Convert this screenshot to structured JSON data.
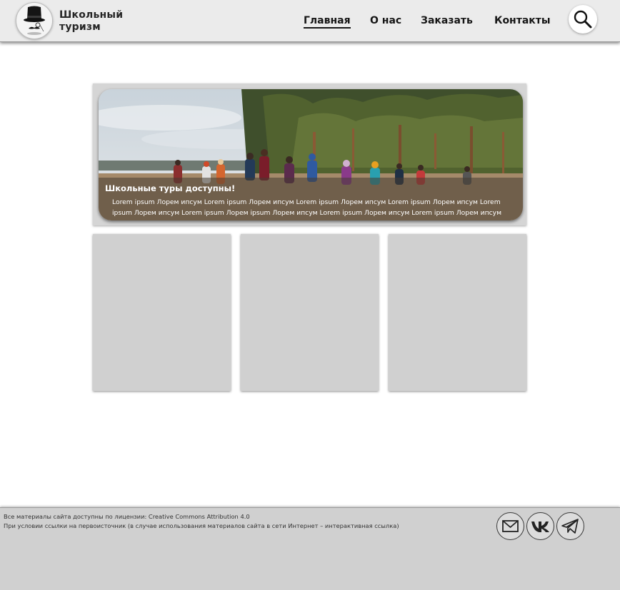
{
  "header": {
    "brand_line1": "Школьный",
    "brand_line2": "туризм",
    "logo_icon": "top-hat-mustache-icon",
    "nav": {
      "home": "Главная",
      "about": "О нас",
      "order": "Заказать",
      "contacts": "Контакты"
    },
    "active_nav": "home",
    "search_icon": "search-icon"
  },
  "hero": {
    "title": "Школьные туры доступны!",
    "text": "Lorem ipsum Лорем ипсум Lorem ipsum Лорем ипсум Lorem ipsum Лорем ипсум Lorem ipsum Лорем ипсум Lorem ipsum Лорем ипсум Lorem ipsum Лорем ipsum Лорем ипсум Lorem ipsum Лорем ипсум Lorem ipsum Лорем ипсум"
  },
  "cards": [
    {
      "id": "card-1"
    },
    {
      "id": "card-2"
    },
    {
      "id": "card-3"
    }
  ],
  "footer": {
    "license_line": "Все материалы сайта доступны по лицензии: Creative Commons Attribution 4.0",
    "attribution_line": "При условии ссылки на первоисточник (в случае использования материалов сайта в сети Интернет – интерактивная ссылка)",
    "social_icons": [
      "mail-icon",
      "vk-icon",
      "telegram-icon"
    ]
  },
  "colors": {
    "header_bg": "#ebebeb",
    "card_bg": "#d0d0d0",
    "footer_bg": "#d0d0d0",
    "text_dark": "#161616"
  }
}
